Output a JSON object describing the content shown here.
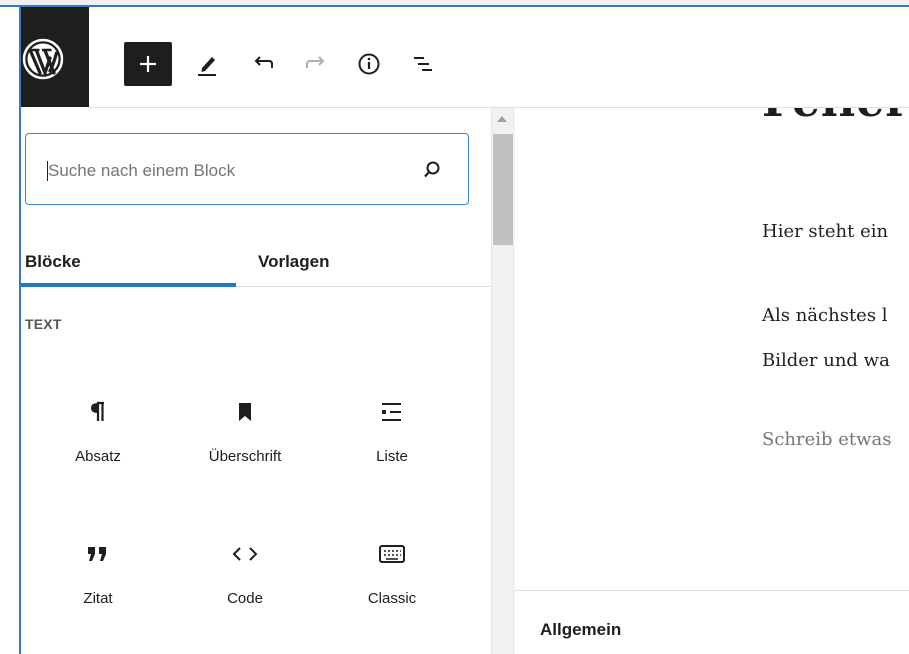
{
  "toolbar": {
    "logo_icon": "wordpress-logo",
    "add_icon": "plus-icon",
    "tools_icon": "pencil-icon",
    "undo_icon": "undo-icon",
    "redo_icon": "redo-icon",
    "details_icon": "info-icon",
    "outline_icon": "list-view-icon"
  },
  "inserter": {
    "search_placeholder": "Suche nach einem Block",
    "tabs": [
      {
        "label": "Blöcke",
        "active": true
      },
      {
        "label": "Vorlagen",
        "active": false
      }
    ],
    "section_label": "TEXT",
    "blocks": [
      {
        "label": "Absatz",
        "icon": "paragraph-icon"
      },
      {
        "label": "Überschrift",
        "icon": "bookmark-icon"
      },
      {
        "label": "Liste",
        "icon": "list-icon"
      },
      {
        "label": "Zitat",
        "icon": "quote-icon"
      },
      {
        "label": "Code",
        "icon": "code-icon"
      },
      {
        "label": "Classic",
        "icon": "keyboard-icon"
      }
    ]
  },
  "editor": {
    "title_partial": "Feller",
    "paragraphs": [
      "Hier steht ein",
      "Als nächstes l",
      "Bilder und wa"
    ],
    "placeholder": "Schreib etwas"
  },
  "meta_panel": {
    "title": "Allgemein"
  },
  "colors": {
    "accent": "#1e7ac3",
    "dark": "#1e1e1e",
    "border": "#e0e0e0"
  }
}
